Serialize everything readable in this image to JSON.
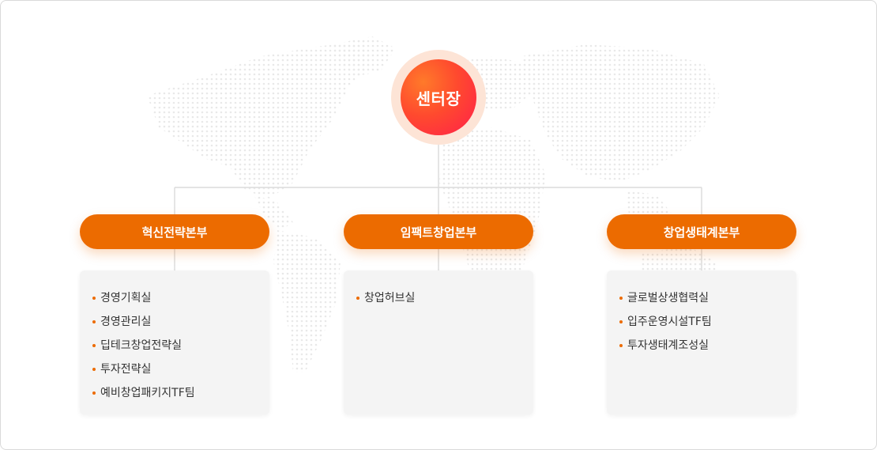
{
  "center": {
    "label": "센터장"
  },
  "departments": [
    {
      "name": "혁신전략본부",
      "teams": [
        "경영기획실",
        "경영관리실",
        "딥테크창업전략실",
        "투자전략실",
        "예비창업패키지TF팀"
      ]
    },
    {
      "name": "임팩트창업본부",
      "teams": [
        "창업허브실"
      ]
    },
    {
      "name": "창업생태계본부",
      "teams": [
        "글로벌상생협력실",
        "입주운영시설TF팀",
        "투자생태계조성실"
      ]
    }
  ],
  "colors": {
    "accent": "#ec6b00",
    "center_gradient": [
      "#ff7a2a",
      "#ff1f4b"
    ],
    "center_halo": "#fde4d6",
    "box_bg": "#f4f4f4",
    "line": "#dcdcdc",
    "map_dots": "#eeeeee"
  }
}
